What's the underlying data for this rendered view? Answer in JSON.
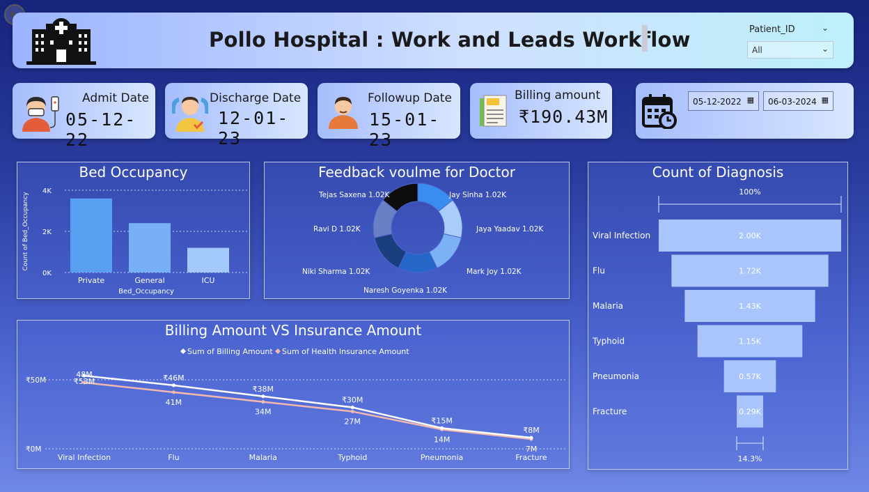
{
  "header": {
    "title": "Pollo Hospital : Work and Leads Workflow",
    "slicer_label": "Patient_ID",
    "slicer_value": "All"
  },
  "kpis": {
    "admit": {
      "label": "Admit Date",
      "value": "05-12-22"
    },
    "discharge": {
      "label": "Discharge Date",
      "value": "12-01-23"
    },
    "followup": {
      "label": "Followup Date",
      "value": "15-01-23"
    },
    "billing": {
      "label": "Billing amount",
      "value": "₹190.43M"
    }
  },
  "date_range": {
    "start": "05-12-2022",
    "end": "06-03-2024"
  },
  "chart_data": [
    {
      "type": "bar",
      "title": "Bed Occupancy",
      "xlabel": "Bed_Occupancy",
      "ylabel": "Count of Bed_Occupancy",
      "categories": [
        "Private",
        "General",
        "ICU"
      ],
      "values": [
        3600,
        2400,
        1200
      ],
      "ylim": [
        0,
        4000
      ],
      "ytick_labels": [
        "0K",
        "2K",
        "4K"
      ],
      "color": "#5aa0f2",
      "grid": true
    },
    {
      "type": "pie",
      "title": "Feedback voulme for Doctor",
      "labels": [
        "Jay Sinha 1.02K",
        "Jaya Yaadav 1.02K",
        "Mark Joy 1.02K",
        "Naresh Goyenka 1.02K",
        "Niki Sharma 1.02K",
        "Ravi D 1.02K",
        "Tejas Saxena 1.02K"
      ],
      "values": [
        1020,
        1020,
        1020,
        1020,
        1020,
        1020,
        1020
      ],
      "colors": [
        "#3b8cf0",
        "#a9cdfb",
        "#7cb1f5",
        "#2467c8",
        "#1b3f7e",
        "#6b7fc4",
        "#0d0d0d"
      ]
    },
    {
      "type": "line",
      "title": "Billing Amount VS Insurance Amount",
      "categories": [
        "Viral Infection",
        "Flu",
        "Malaria",
        "Typhoid",
        "Pneumonia",
        "Fracture"
      ],
      "series": [
        {
          "name": "Sum of Billing Amount",
          "values": [
            53,
            46,
            38,
            30,
            15,
            8
          ],
          "labels": [
            "₹53M",
            "₹46M",
            "₹38M",
            "₹30M",
            "₹15M",
            "₹8M"
          ],
          "color": "#ffffff"
        },
        {
          "name": "Sum of Health Insurance Amount",
          "values": [
            48,
            41,
            34,
            27,
            14,
            7
          ],
          "labels": [
            "48M",
            "41M",
            "34M",
            "27M",
            "14M",
            "7M"
          ],
          "color": "#f2b8b0"
        }
      ],
      "ylim": [
        0,
        50
      ],
      "ytick_labels": [
        "₹0M",
        "₹50M"
      ],
      "legend": "top-center"
    },
    {
      "type": "bar",
      "orientation": "funnel",
      "title": "Count of Diagnosis",
      "categories": [
        "Viral Infection",
        "Flu",
        "Malaria",
        "Typhoid",
        "Pneumonia",
        "Fracture"
      ],
      "values": [
        2000,
        1720,
        1430,
        1150,
        570,
        290
      ],
      "value_labels": [
        "2.00K",
        "1.72K",
        "1.43K",
        "1.15K",
        "0.57K",
        "0.29K"
      ],
      "top_percent": "100%",
      "bottom_percent": "14.3%",
      "color": "#a9c5fb"
    }
  ]
}
